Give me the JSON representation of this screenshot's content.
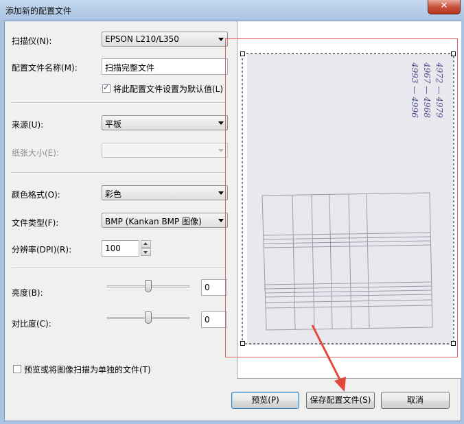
{
  "window": {
    "title": "添加新的配置文件",
    "close_glyph": "✕"
  },
  "form": {
    "scanner_label": "扫描仪(N):",
    "scanner_value": "EPSON L210/L350",
    "profile_name_label": "配置文件名称(M):",
    "profile_name_value": "扫描完整文件",
    "default_checkbox_label": "将此配置文件设置为默认值(L)",
    "default_checked": true,
    "source_label": "来源(U):",
    "source_value": "平板",
    "paper_size_label": "纸张大小(E):",
    "paper_size_value": "",
    "color_format_label": "颜色格式(O):",
    "color_format_value": "彩色",
    "file_type_label": "文件类型(F):",
    "file_type_value": "BMP (Kankan BMP 图像)",
    "resolution_label": "分辨率(DPI)(R):",
    "resolution_value": "100",
    "brightness_label": "亮度(B):",
    "brightness_value": "0",
    "contrast_label": "对比度(C):",
    "contrast_value": "0",
    "separate_files_label": "预览或将图像扫描为单独的文件(T)",
    "separate_files_checked": false
  },
  "preview": {
    "handwriting_lines": [
      "4972 — 4979",
      "4967 — 4968",
      "4993 — 4996"
    ]
  },
  "buttons": {
    "preview": "预览(P)",
    "save": "保存配置文件(S)",
    "cancel": "取消"
  },
  "colors": {
    "annotation_red": "#e0483c",
    "selection_border": "#e06464"
  }
}
